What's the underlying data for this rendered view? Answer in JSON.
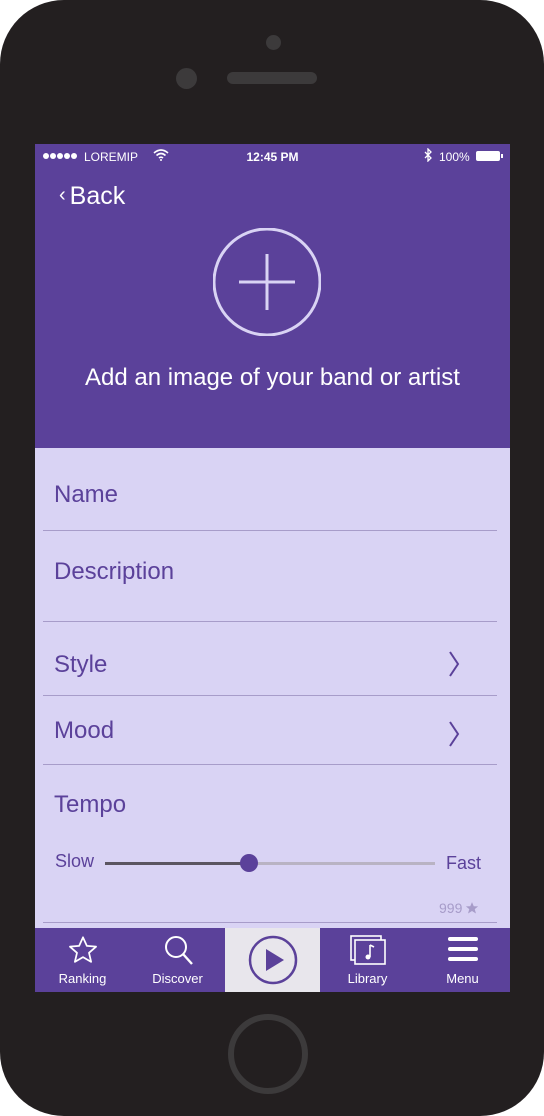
{
  "status_bar": {
    "carrier": "LOREMIP",
    "time": "12:45 PM",
    "battery": "100%"
  },
  "header": {
    "back_label": "Back",
    "add_caption": "Add an image of your band or artist"
  },
  "form": {
    "name_label": "Name",
    "description_label": "Description",
    "style_label": "Style",
    "mood_label": "Mood",
    "tempo_label": "Tempo",
    "tempo_min_label": "Slow",
    "tempo_max_label": "Fast",
    "tempo_value": 0.44,
    "rating_count": "999"
  },
  "tabs": [
    {
      "label": "Ranking",
      "icon": "star-icon"
    },
    {
      "label": "Discover",
      "icon": "search-icon"
    },
    {
      "label": "",
      "icon": "play-icon",
      "active": true
    },
    {
      "label": "Library",
      "icon": "library-icon"
    },
    {
      "label": "Menu",
      "icon": "menu-icon"
    }
  ],
  "colors": {
    "accent": "#5b419a",
    "form_bg": "#d9d3f4",
    "phone": "#231f20"
  }
}
